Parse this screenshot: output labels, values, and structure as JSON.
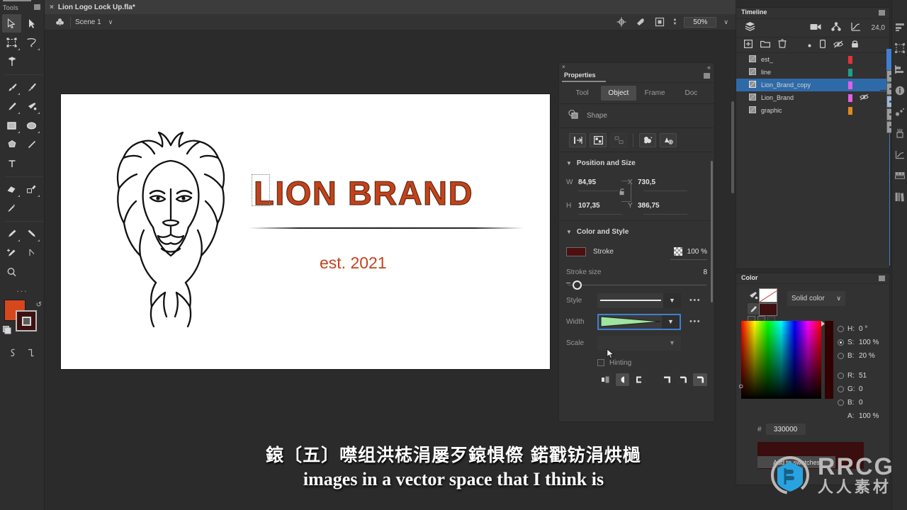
{
  "tools": {
    "title": "Tools",
    "items": [
      {
        "name": "selection-tool",
        "label": "Selection",
        "active": true
      },
      {
        "name": "subselection-tool",
        "label": "Subselection",
        "active": false
      },
      {
        "name": "free-transform-tool",
        "label": "Free Transform",
        "active": false
      },
      {
        "name": "lasso-tool",
        "label": "Lasso",
        "active": false
      },
      {
        "name": "bone-tool",
        "label": "Bone",
        "active": false
      },
      {
        "name": "paint-brush-tool",
        "label": "Paint Brush",
        "active": false
      },
      {
        "name": "brush-tool",
        "label": "Brush",
        "active": false
      },
      {
        "name": "pencil-tool",
        "label": "Pencil",
        "active": false
      },
      {
        "name": "paint-bucket-tool",
        "label": "Paint Bucket",
        "active": false
      },
      {
        "name": "rectangle-tool",
        "label": "Rectangle",
        "active": false
      },
      {
        "name": "oval-tool",
        "label": "Oval",
        "active": false
      },
      {
        "name": "polystar-tool",
        "label": "PolyStar",
        "active": false
      },
      {
        "name": "line-tool",
        "label": "Line",
        "active": false
      },
      {
        "name": "text-tool",
        "label": "Text",
        "active": false
      },
      {
        "name": "eraser-tool",
        "label": "Eraser",
        "active": false
      },
      {
        "name": "width-tool",
        "label": "Width",
        "active": false
      },
      {
        "name": "eyedropper-tool",
        "label": "Eyedropper",
        "active": false
      },
      {
        "name": "ink-bottle-tool",
        "label": "Ink Bottle",
        "active": false
      },
      {
        "name": "fill-tool",
        "label": "Fill",
        "active": false
      },
      {
        "name": "add-anchor-tool",
        "label": "Add Anchor Point",
        "active": false
      },
      {
        "name": "pen-tool",
        "label": "Pen",
        "active": false
      },
      {
        "name": "zoom-tool",
        "label": "Zoom",
        "active": false
      }
    ],
    "overflow_label": "...",
    "fill_color": "#d6471d",
    "stroke_color": "#3e1111"
  },
  "document": {
    "tab_label": "Lion Logo Lock Up.fla*",
    "close_label": "×"
  },
  "stage_toolbar": {
    "scene_label": "Scene 1",
    "caret": "∨",
    "zoom_value": "50%",
    "icons": [
      "center-stage-icon",
      "rotate-stage-icon",
      "clip-content-icon"
    ]
  },
  "canvas": {
    "brand_title": "LION BRAND",
    "established": "est. 2021",
    "brand_color": "#c4421b",
    "background": "#ffffff"
  },
  "properties": {
    "panel_title": "Properties",
    "close_label": "×",
    "collapse_label": "«",
    "tabs": [
      {
        "label": "Tool",
        "active": false
      },
      {
        "label": "Object",
        "active": true
      },
      {
        "label": "Frame",
        "active": false
      },
      {
        "label": "Doc",
        "active": false
      }
    ],
    "object_type": "Shape",
    "align_buttons": [
      {
        "name": "align-horizontal-icon",
        "disabled": false
      },
      {
        "name": "distribute-icon",
        "disabled": false
      },
      {
        "name": "match-size-icon",
        "disabled": true
      },
      {
        "name": "union-icon",
        "disabled": false
      },
      {
        "name": "combine-icon",
        "disabled": false
      }
    ],
    "position_and_size": {
      "section_label": "Position and Size",
      "w_label": "W",
      "w_value": "84,95",
      "h_label": "H",
      "h_value": "107,35",
      "x_label": "X",
      "x_value": "730,5",
      "y_label": "Y",
      "y_value": "386,75",
      "lock_icon": "unlock-icon"
    },
    "color_and_style": {
      "section_label": "Color and Style",
      "stroke_label": "Stroke",
      "stroke_color": "#4d1011",
      "stroke_alpha": "100 %",
      "stroke_size_label": "Stroke size",
      "stroke_size_value": "8",
      "style_label": "Style",
      "style_value": "Solid",
      "width_label": "Width",
      "width_value": "Tapered",
      "scale_label": "Scale",
      "scale_value": "",
      "hinting_label": "Hinting",
      "hinting_checked": false,
      "dots_label": "•••",
      "cap_buttons": [
        {
          "name": "cap-none-icon",
          "active": false
        },
        {
          "name": "cap-round-icon",
          "active": true
        },
        {
          "name": "cap-square-icon",
          "active": false
        }
      ],
      "join_buttons": [
        {
          "name": "join-miter-icon",
          "active": false
        },
        {
          "name": "join-round-icon",
          "active": false
        },
        {
          "name": "join-bevel-icon",
          "active": true
        }
      ]
    }
  },
  "timeline": {
    "panel_title": "Timeline",
    "fps_label": "24,0",
    "toolbar_icons": [
      "camera-icon",
      "rig-icon",
      "graph-editor-icon"
    ],
    "layer_toolbar_icons": [
      "new-layer-icon",
      "new-folder-icon",
      "delete-layer-icon"
    ],
    "column_icons": [
      "outline-dot-icon",
      "guide-icon",
      "visibility-icon",
      "lock-icon"
    ],
    "layers": [
      {
        "name": "est_",
        "color": "#e2323a",
        "hidden": false,
        "selected": false
      },
      {
        "name": "line",
        "color": "#1ea08a",
        "hidden": false,
        "selected": false
      },
      {
        "name": "Lion_Brand_copy",
        "color": "#e060e8",
        "hidden": false,
        "selected": true
      },
      {
        "name": "Lion_Brand",
        "color": "#e060e8",
        "hidden": true,
        "selected": false
      },
      {
        "name": "graphic",
        "color": "#e08a1e",
        "hidden": false,
        "selected": false
      }
    ]
  },
  "color_panel": {
    "panel_title": "Color",
    "color_type": "Solid color",
    "caret": "∨",
    "fields": [
      {
        "key": "H:",
        "value": "0 °",
        "selected": false
      },
      {
        "key": "S:",
        "value": "100 %",
        "selected": true
      },
      {
        "key": "B:",
        "value": "20 %",
        "selected": false
      },
      {
        "key": "R:",
        "value": "51",
        "selected": false
      },
      {
        "key": "G:",
        "value": "0",
        "selected": false
      },
      {
        "key": "B:",
        "value": "0",
        "selected": false
      }
    ],
    "alpha_key": "A:",
    "alpha_value": "100 %",
    "hex_prefix": "#",
    "hex_value": "330000",
    "add_swatch_label": "Add to swatches",
    "current_color": "#330000"
  },
  "right_rail": {
    "icons": [
      "align-panel-icon",
      "transform-panel-icon",
      "info-panel-icon",
      "effects-panel-icon",
      "assets-panel-icon",
      "graph-panel-icon",
      "frame-picker-icon",
      "library-panel-icon"
    ]
  },
  "subtitles": {
    "cjk_line": "鎄〔五〕噤组洪梽涓屡歹鎄惧傺 鍩戳钫涓烘檛",
    "english_line": "images in a vector space that I think is"
  },
  "watermark": {
    "brand": "RRCG",
    "subtitle": "人人素材",
    "accent_color": "#29a3e0"
  }
}
